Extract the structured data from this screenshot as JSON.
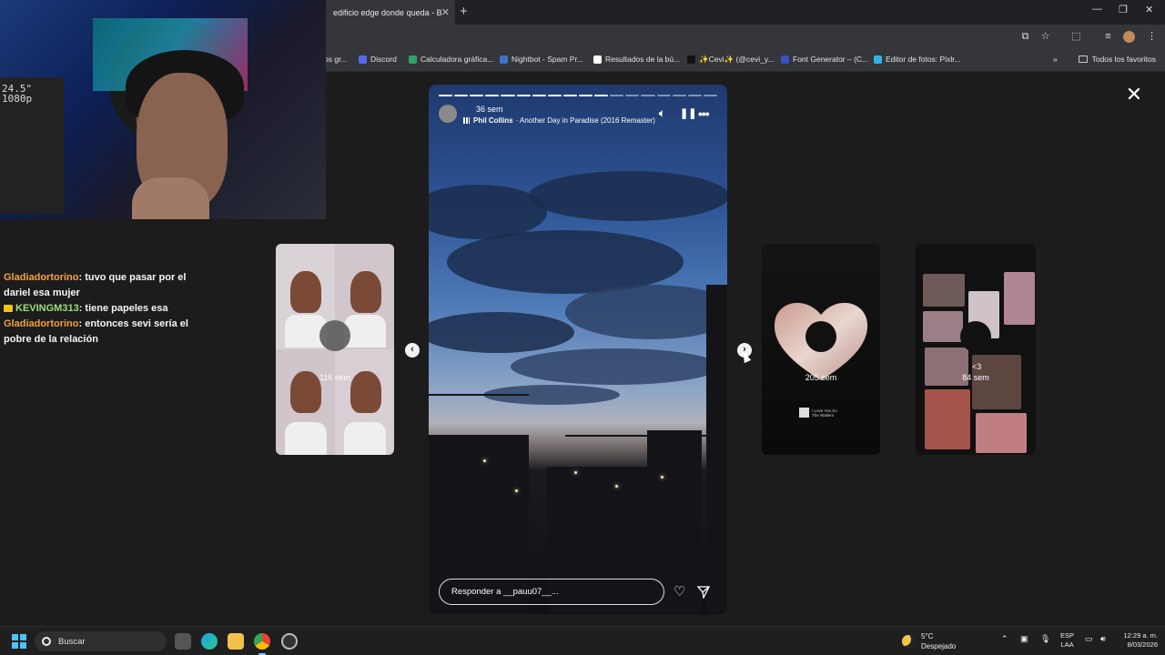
{
  "browser": {
    "active_tab_title": "edificio edge donde queda - B",
    "bookmarks": [
      {
        "label": "os gr...",
        "color": "#555555"
      },
      {
        "label": "Discord",
        "color": "#5865f2"
      },
      {
        "label": "Calculadora gráfica...",
        "color": "#2ea36a"
      },
      {
        "label": "Nightbot - Spam Pr...",
        "color": "#3b74c9"
      },
      {
        "label": "Resultados de la bú...",
        "color": "#ffffff"
      },
      {
        "label": "✨Cevi✨ (@cevi_y...",
        "color": "#111111"
      },
      {
        "label": "Font Generator – (C...",
        "color": "#3451c5"
      },
      {
        "label": "Editor de fotos: Pixlr...",
        "color": "#2fb3e6"
      }
    ],
    "all_bookmarks": "Todos los favoritos"
  },
  "webcam": {
    "monitor_label": "24.5\"\n1080p"
  },
  "chat": [
    {
      "user": "Gladiadortorino",
      "message": ": tuvo que pasar por el dariel esa mujer",
      "color": "#f4a040",
      "badge": false
    },
    {
      "user": "KEVINGM313",
      "message": ": tiene papeles esa",
      "color": "#9be07a",
      "badge": true
    },
    {
      "user": "Gladiadortorino",
      "message": ": entonces sevi sería el pobre de la relación",
      "color": "#f4a040",
      "badge": false
    }
  ],
  "story": {
    "time": "36 sem",
    "artist": "Phil Collins",
    "song": " · Another Day in Paradise (2016 Remaster)",
    "reply_placeholder": "Responder a __pauu07__...",
    "progress_total": 18,
    "progress_done": 11
  },
  "previews": {
    "left": {
      "age": "116 sem"
    },
    "right1": {
      "age": "205 sem",
      "song_line1": "I Love You So",
      "song_line2": "The Walters"
    },
    "right2": {
      "age": "84 sem",
      "caption": "<3"
    }
  },
  "taskbar": {
    "search": "Buscar",
    "weather_temp": "5°C",
    "weather_desc": "Despejado",
    "lang1": "ESP",
    "lang2": "LAA",
    "time": "12:29 a. m.",
    "date": "8/03/2026"
  }
}
